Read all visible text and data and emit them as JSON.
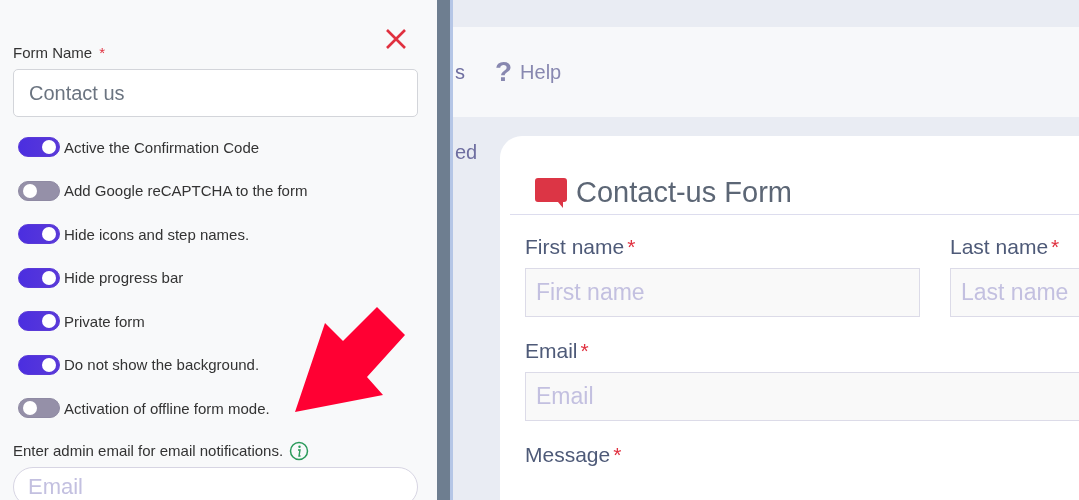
{
  "settings_panel": {
    "form_name_label": "Form Name",
    "required_mark": "*",
    "form_name_value": "Contact us",
    "options": [
      {
        "label": "Active the Confirmation Code",
        "on": true
      },
      {
        "label": "Add Google reCAPTCHA to the form",
        "on": false
      },
      {
        "label": "Hide icons and step names.",
        "on": true
      },
      {
        "label": "Hide progress bar",
        "on": true
      },
      {
        "label": "Private form",
        "on": true
      },
      {
        "label": "Do not show the background.",
        "on": true
      },
      {
        "label": "Activation of offline form mode.",
        "on": false
      }
    ],
    "admin_email_label": "Enter admin email for email notifications.",
    "admin_email_placeholder": "Email"
  },
  "header": {
    "nav_item_cut": "s",
    "help_icon": "?",
    "help_label": "Help"
  },
  "sidebar_item_cut": "ed",
  "form": {
    "title": "Contact-us Form",
    "required_mark": "*",
    "fields": [
      {
        "label": "First name",
        "placeholder": "First name",
        "required": true
      },
      {
        "label": "Last name",
        "placeholder": "Last name",
        "required": true
      },
      {
        "label": "Email",
        "placeholder": "Email",
        "required": true
      },
      {
        "label": "Message",
        "required": true
      }
    ]
  }
}
